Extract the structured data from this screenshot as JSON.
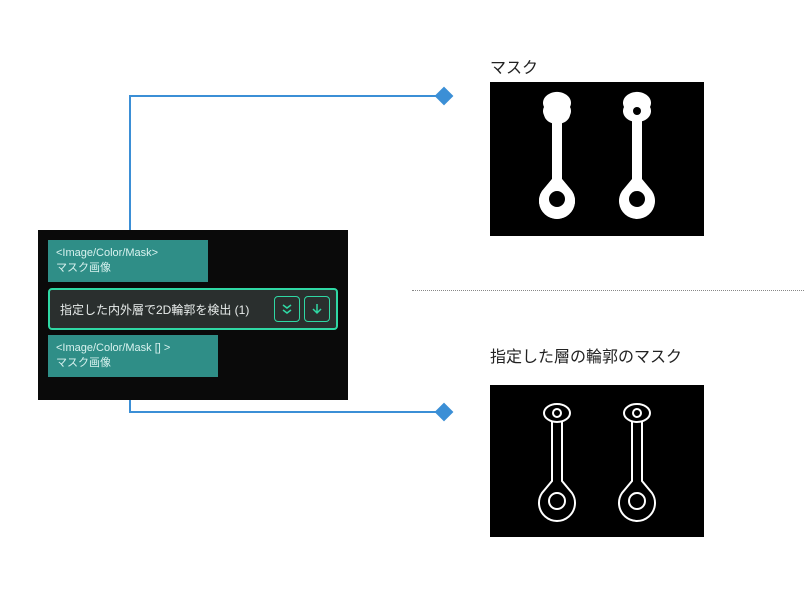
{
  "node": {
    "input_port": {
      "type_label": "<Image/Color/Mask>",
      "name_label": "マスク画像"
    },
    "operation": {
      "label": "指定した内外層で2D輪郭を検出 (1)"
    },
    "output_port": {
      "type_label": "<Image/Color/Mask [] >",
      "name_label": "マスク画像"
    }
  },
  "labels": {
    "top_image": "マスク",
    "bottom_image": "指定した層の輪郭のマスク"
  },
  "colors": {
    "connector": "#3b8fd6",
    "port_bg": "#2f8e87",
    "node_accent": "#2fd8a4"
  }
}
